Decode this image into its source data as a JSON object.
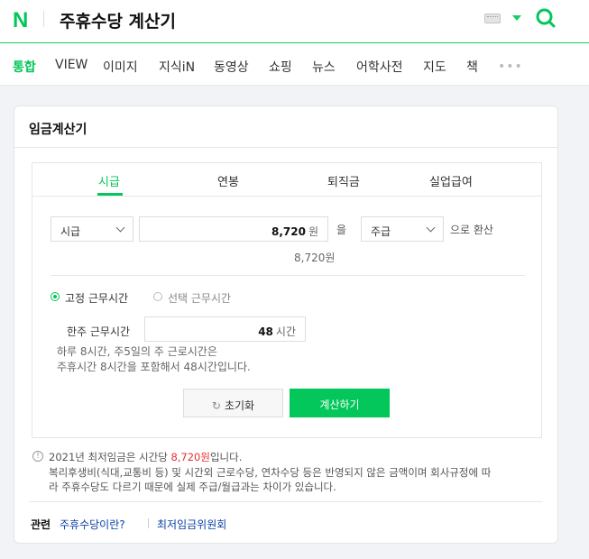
{
  "header": {
    "logo": "N",
    "query": "주휴수당 계산기",
    "icons": {
      "keyboard": "keyboard-icon",
      "caret": "caret-down-icon",
      "search": "search-icon"
    },
    "accent_color": "#03c75a"
  },
  "tabs": [
    "통합",
    "VIEW",
    "이미지",
    "지식iN",
    "동영상",
    "쇼핑",
    "뉴스",
    "어학사전",
    "지도",
    "책"
  ],
  "more_label": "•••",
  "card": {
    "title": "임금계산기",
    "calc_tabs": [
      "시급",
      "연봉",
      "퇴직금",
      "실업급여"
    ],
    "row1": {
      "unit_select": "시급",
      "amount": "8,720",
      "amount_unit": "원",
      "particle": "을",
      "target_select": "주급",
      "suffix": "으로 환산",
      "amount_caption": "8,720원"
    },
    "radio_fixed": "고정 근무시간",
    "radio_select": "선택 근무시간",
    "hours_label": "한주 근무시간",
    "hours_value": "48",
    "hours_unit": "시간",
    "help_line1": "하루 8시간, 주5일의 주 근로시간은",
    "help_line2": "주휴시간 8시간을 포함해서 48시간입니다.",
    "reset_label": "초기화",
    "calc_label": "계산하기"
  },
  "notes": {
    "line1_prefix": "2021년 최저임금은 시간당 ",
    "line1_wage": "8,720원",
    "line1_suffix": "입니다.",
    "line2": "복리후생비(식대,교통비 등) 및 시간외 근로수당, 연차수당 등은 반영되지 않은 금액이며 회사규정에 따",
    "line3": "라 주휴수당도 다르기 때문에 실제 주급/월급과는 차이가 있습니다."
  },
  "related": {
    "label": "관련",
    "link1": "주휴수당이란?",
    "link2": "최저임금위원회"
  }
}
